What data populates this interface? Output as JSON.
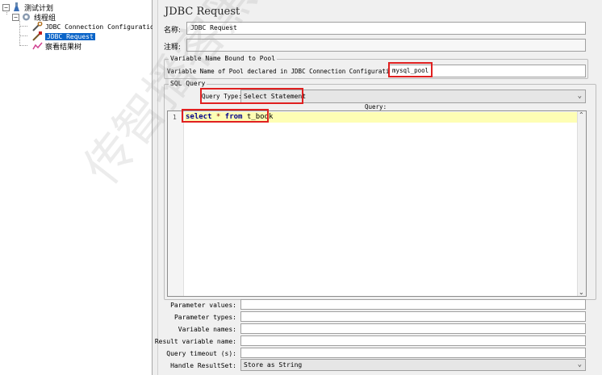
{
  "tree": {
    "root": "测试计划",
    "thread_group": "线程组",
    "items": [
      {
        "label": "JDBC Connection Configuration",
        "icon": "wrench-icon"
      },
      {
        "label": "JDBC Request",
        "icon": "pipette-icon",
        "selected": true
      },
      {
        "label": "察看结果树",
        "icon": "chart-icon"
      }
    ]
  },
  "panel": {
    "title": "JDBC Request",
    "name_label": "名称:",
    "name_value": "JDBC Request",
    "comment_label": "注释:",
    "comment_value": ""
  },
  "pool_group": {
    "title": "Variable Name Bound to Pool",
    "label": "Variable Name of Pool declared in JDBC Connection Configuration:",
    "value": "mysql_pool"
  },
  "sql_group": {
    "title": "SQL Query",
    "query_type_label": "Query Type:",
    "query_type_value": "Select Statement",
    "query_label": "Query:",
    "line_number": "1",
    "query_tokens": [
      "select",
      " * ",
      "from",
      " t_book"
    ]
  },
  "params": [
    {
      "label": "Parameter values:",
      "value": ""
    },
    {
      "label": "Parameter types:",
      "value": ""
    },
    {
      "label": "Variable names:",
      "value": ""
    },
    {
      "label": "Result variable name:",
      "value": ""
    },
    {
      "label": "Query timeout (s):",
      "value": ""
    }
  ],
  "result_set": {
    "label": "Handle ResultSet:",
    "value": "Store as String"
  },
  "watermark": "传智播客黑马程序",
  "colors": {
    "selection": "#0a64c8",
    "highlight_border": "#e02020",
    "current_line": "#fefeb4",
    "keyword": "#00008b"
  }
}
